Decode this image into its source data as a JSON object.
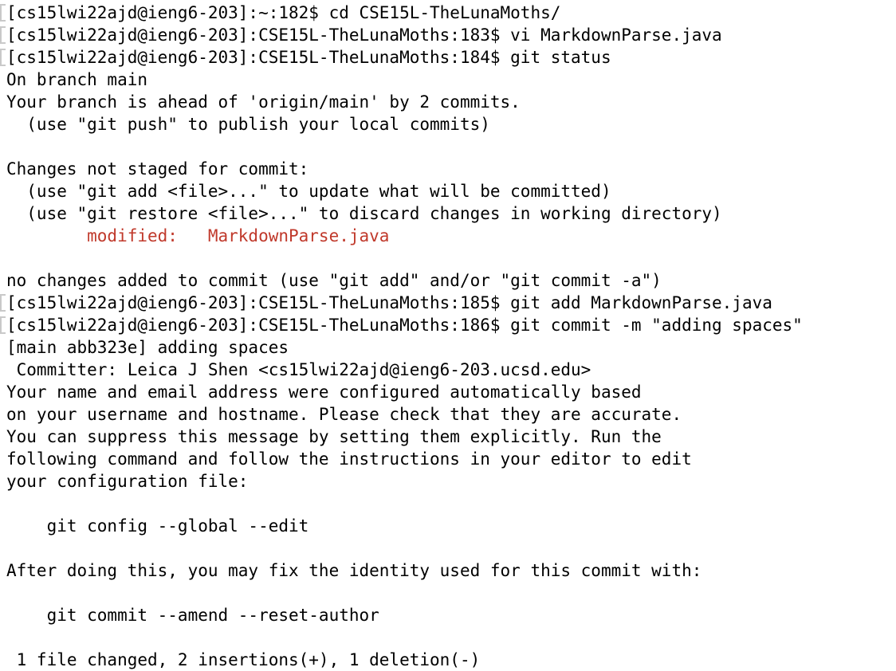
{
  "colors": {
    "background": "#ffffff",
    "text": "#000000",
    "modified": "#c0392b"
  },
  "terminal": {
    "lines": [
      {
        "text": "[cs15lwi22ajd@ieng6-203]:~:182$ cd CSE15L-TheLunaMoths/",
        "type": "prompt"
      },
      {
        "text": "[cs15lwi22ajd@ieng6-203]:CSE15L-TheLunaMoths:183$ vi MarkdownParse.java",
        "type": "prompt"
      },
      {
        "text": "[cs15lwi22ajd@ieng6-203]:CSE15L-TheLunaMoths:184$ git status",
        "type": "prompt"
      },
      {
        "text": "On branch main",
        "type": "output"
      },
      {
        "text": "Your branch is ahead of 'origin/main' by 2 commits.",
        "type": "output"
      },
      {
        "text": "  (use \"git push\" to publish your local commits)",
        "type": "output"
      },
      {
        "text": "",
        "type": "output"
      },
      {
        "text": "Changes not staged for commit:",
        "type": "output"
      },
      {
        "text": "  (use \"git add <file>...\" to update what will be committed)",
        "type": "output"
      },
      {
        "text": "  (use \"git restore <file>...\" to discard changes in working directory)",
        "type": "output"
      },
      {
        "text": "        modified:   MarkdownParse.java",
        "type": "modified"
      },
      {
        "text": "",
        "type": "output"
      },
      {
        "text": "no changes added to commit (use \"git add\" and/or \"git commit -a\")",
        "type": "output"
      },
      {
        "text": "[cs15lwi22ajd@ieng6-203]:CSE15L-TheLunaMoths:185$ git add MarkdownParse.java",
        "type": "prompt"
      },
      {
        "text": "[cs15lwi22ajd@ieng6-203]:CSE15L-TheLunaMoths:186$ git commit -m \"adding spaces\"",
        "type": "prompt"
      },
      {
        "text": "[main abb323e] adding spaces",
        "type": "output"
      },
      {
        "text": " Committer: Leica J Shen <cs15lwi22ajd@ieng6-203.ucsd.edu>",
        "type": "output"
      },
      {
        "text": "Your name and email address were configured automatically based",
        "type": "output"
      },
      {
        "text": "on your username and hostname. Please check that they are accurate.",
        "type": "output"
      },
      {
        "text": "You can suppress this message by setting them explicitly. Run the",
        "type": "output"
      },
      {
        "text": "following command and follow the instructions in your editor to edit",
        "type": "output"
      },
      {
        "text": "your configuration file:",
        "type": "output"
      },
      {
        "text": "",
        "type": "output"
      },
      {
        "text": "    git config --global --edit",
        "type": "output"
      },
      {
        "text": "",
        "type": "output"
      },
      {
        "text": "After doing this, you may fix the identity used for this commit with:",
        "type": "output"
      },
      {
        "text": "",
        "type": "output"
      },
      {
        "text": "    git commit --amend --reset-author",
        "type": "output"
      },
      {
        "text": "",
        "type": "output"
      },
      {
        "text": " 1 file changed, 2 insertions(+), 1 deletion(-)",
        "type": "output"
      }
    ]
  }
}
